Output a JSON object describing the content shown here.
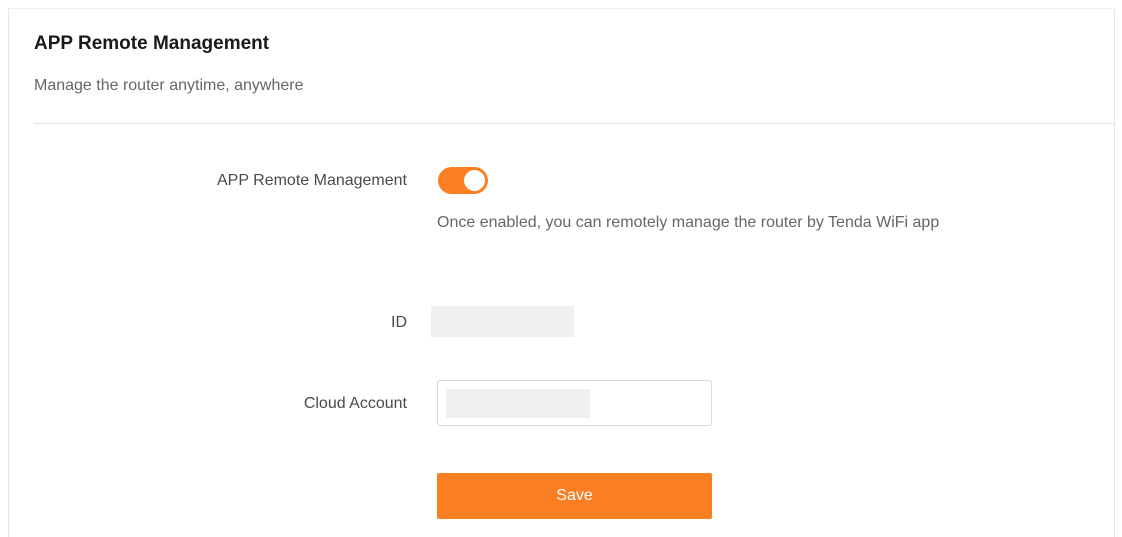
{
  "header": {
    "title": "APP Remote Management",
    "subtitle": "Manage the router anytime, anywhere"
  },
  "form": {
    "remote_management": {
      "label": "APP Remote Management",
      "enabled": true,
      "hint": "Once enabled, you can remotely manage the router by Tenda WiFi app"
    },
    "id": {
      "label": "ID",
      "value": ""
    },
    "cloud_account": {
      "label": "Cloud Account",
      "value": "",
      "placeholder": ""
    },
    "save_label": "Save"
  },
  "colors": {
    "accent": "#fa7f22",
    "masked_field": "#efefef"
  }
}
